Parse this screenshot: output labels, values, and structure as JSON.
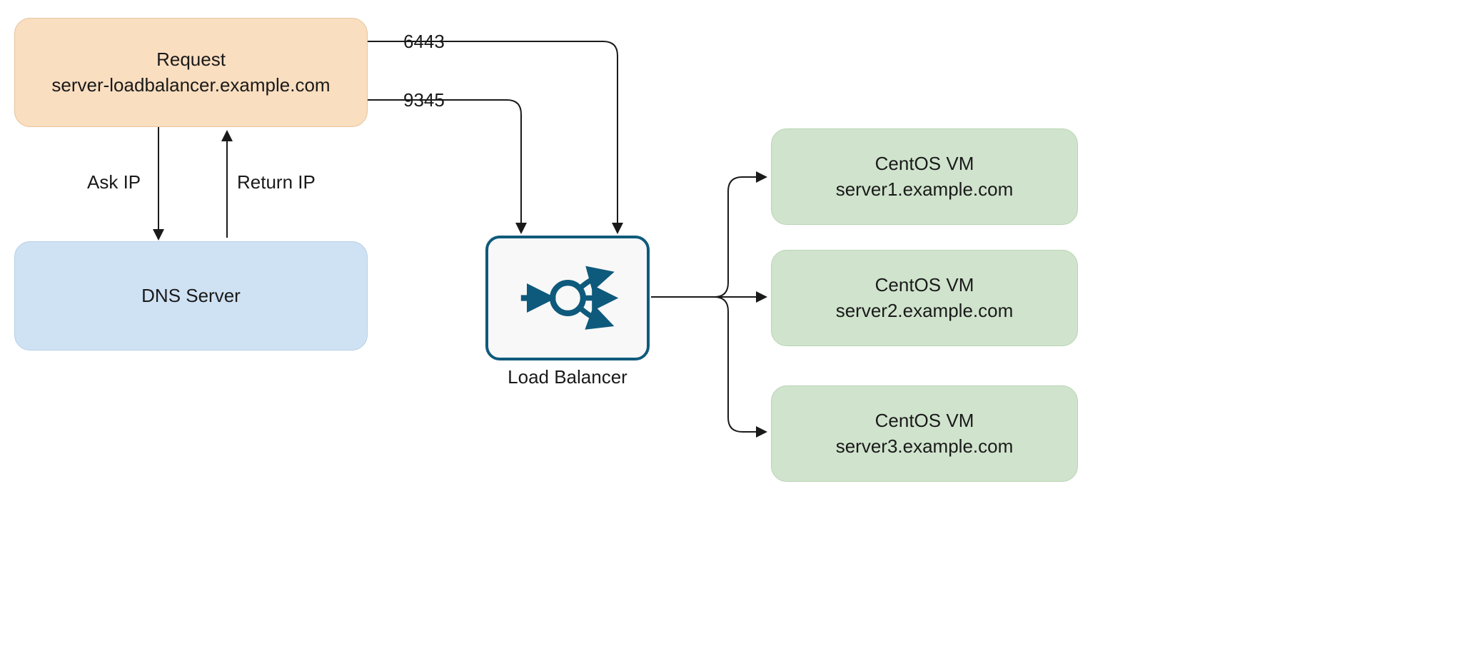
{
  "request": {
    "line1": "Request",
    "line2": "server-loadbalancer.example.com"
  },
  "dns": {
    "label": "DNS Server"
  },
  "edges": {
    "ask_ip": "Ask IP",
    "return_ip": "Return IP",
    "port1": "6443",
    "port2": "9345"
  },
  "load_balancer": {
    "label": "Load Balancer"
  },
  "vms": [
    {
      "line1": "CentOS VM",
      "line2": "server1.example.com"
    },
    {
      "line1": "CentOS VM",
      "line2": "server2.example.com"
    },
    {
      "line1": "CentOS VM",
      "line2": "server3.example.com"
    }
  ],
  "colors": {
    "request_fill": "#fadec0",
    "dns_fill": "#cfe2f3",
    "vm_fill": "#d0e4cd",
    "lb_border": "#0e5a7c",
    "arrow": "#1a1a1a"
  }
}
